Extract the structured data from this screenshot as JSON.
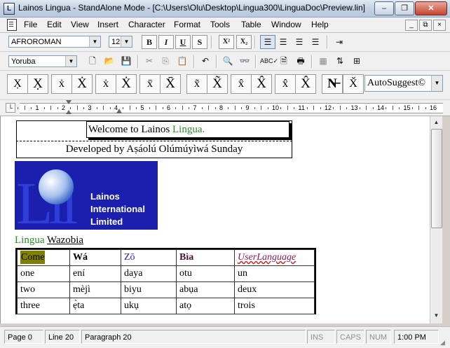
{
  "window": {
    "title": "Lainos Lingua - StandAlone Mode - [C:\\Users\\Olu\\Desktop\\Lingua300\\LinguaDoc\\Preview.lin]",
    "app_icon_glyph": "L",
    "minimize_glyph": "–",
    "restore_glyph": "❐",
    "close_glyph": "✕"
  },
  "menu": [
    "File",
    "Edit",
    "View",
    "Insert",
    "Character",
    "Format",
    "Tools",
    "Table",
    "Window",
    "Help"
  ],
  "mdi": {
    "minimize": "_",
    "restore": "⧉",
    "close": "×"
  },
  "format_bar": {
    "font": "AFROROMAN",
    "size": "12",
    "bold": "B",
    "italic": "I",
    "underline": "U",
    "strike": "S",
    "superscript": "X²",
    "subscript": "X₂"
  },
  "standard_bar": {
    "language": "Yoruba"
  },
  "char_buttons": [
    "X̣",
    "X̣",
    "ẋ",
    "Ẋ",
    "ẋ",
    "Ẋ",
    "x̄",
    "X̄",
    "x̃",
    "X̃",
    "x̂",
    "X̂",
    "x̂",
    "X̂",
    "N̶",
    "X̌"
  ],
  "autosuggest": "AutoSuggest©",
  "ruler_numbers": [
    "1",
    "2",
    "3",
    "4",
    "5",
    "6",
    "7",
    "8",
    "9",
    "10",
    "11",
    "12",
    "13",
    "14",
    "15",
    "16"
  ],
  "document": {
    "welcome_prefix": "Welcome to Lainos ",
    "welcome_lingua": "Lingua.",
    "developed_by": "Developed by Aṣáolú Olúmúyìwá Sunday",
    "logo_letters": "Lil",
    "logo_line1": "Lainos",
    "logo_line2": "International",
    "logo_line3": "Limited",
    "caption_lingua": "Lingua",
    "caption_wazobia": "Wazobia",
    "table": {
      "headers": [
        "Come",
        "Wá",
        "Zō",
        "Bìa",
        "UserLanguage"
      ],
      "rows": [
        [
          "one",
          "ení",
          "daya",
          "otu",
          "un"
        ],
        [
          "two",
          "mèjì",
          "biyu",
          "abụa",
          "deux"
        ],
        [
          "three",
          "ẹ̀ta",
          "ukụ",
          "atọ",
          "trois"
        ]
      ]
    }
  },
  "status": {
    "page": "Page 0",
    "line": "Line 20",
    "paragraph": "Paragraph 20",
    "ins": "INS",
    "caps": "CAPS",
    "num": "NUM",
    "time": "1:00 PM"
  },
  "colors": {
    "lingua_green": "#2e8b2e",
    "logo_blue": "#1a1fae",
    "highlight": "#808000",
    "link_purple": "#8b1a5a"
  }
}
